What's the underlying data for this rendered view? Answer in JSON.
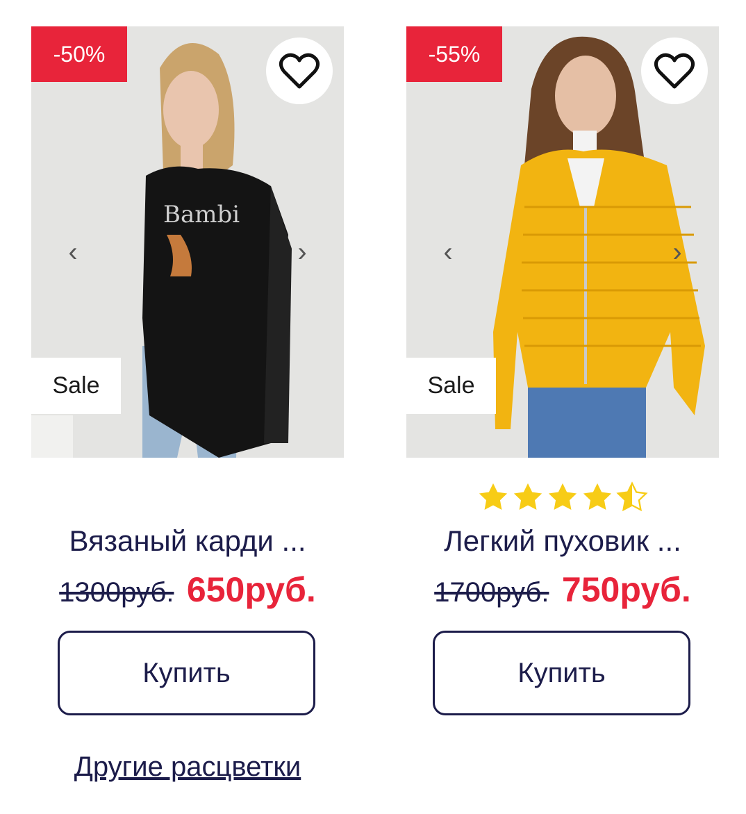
{
  "products": [
    {
      "discount": "-50%",
      "sale_label": "Sale",
      "title": "Вязаный карди ...",
      "old_price": "1300руб.",
      "new_price": "650руб.",
      "buy_label": "Купить",
      "other_colors_label": "Другие расцветки",
      "prev_arrow": "‹",
      "next_arrow": "›",
      "favorite_icon": "heart-outline-icon",
      "photo_text": "Bambi"
    },
    {
      "discount": "-55%",
      "sale_label": "Sale",
      "title": "Легкий пуховик ...",
      "old_price": "1700руб.",
      "new_price": "750руб.",
      "buy_label": "Купить",
      "prev_arrow": "‹",
      "next_arrow": "›",
      "favorite_icon": "heart-outline-icon",
      "rating": 4.5,
      "rating_max": 5
    }
  ],
  "colors": {
    "accent_red": "#e8243a",
    "text_navy": "#1c1c4a",
    "star_yellow": "#f7cc16"
  }
}
